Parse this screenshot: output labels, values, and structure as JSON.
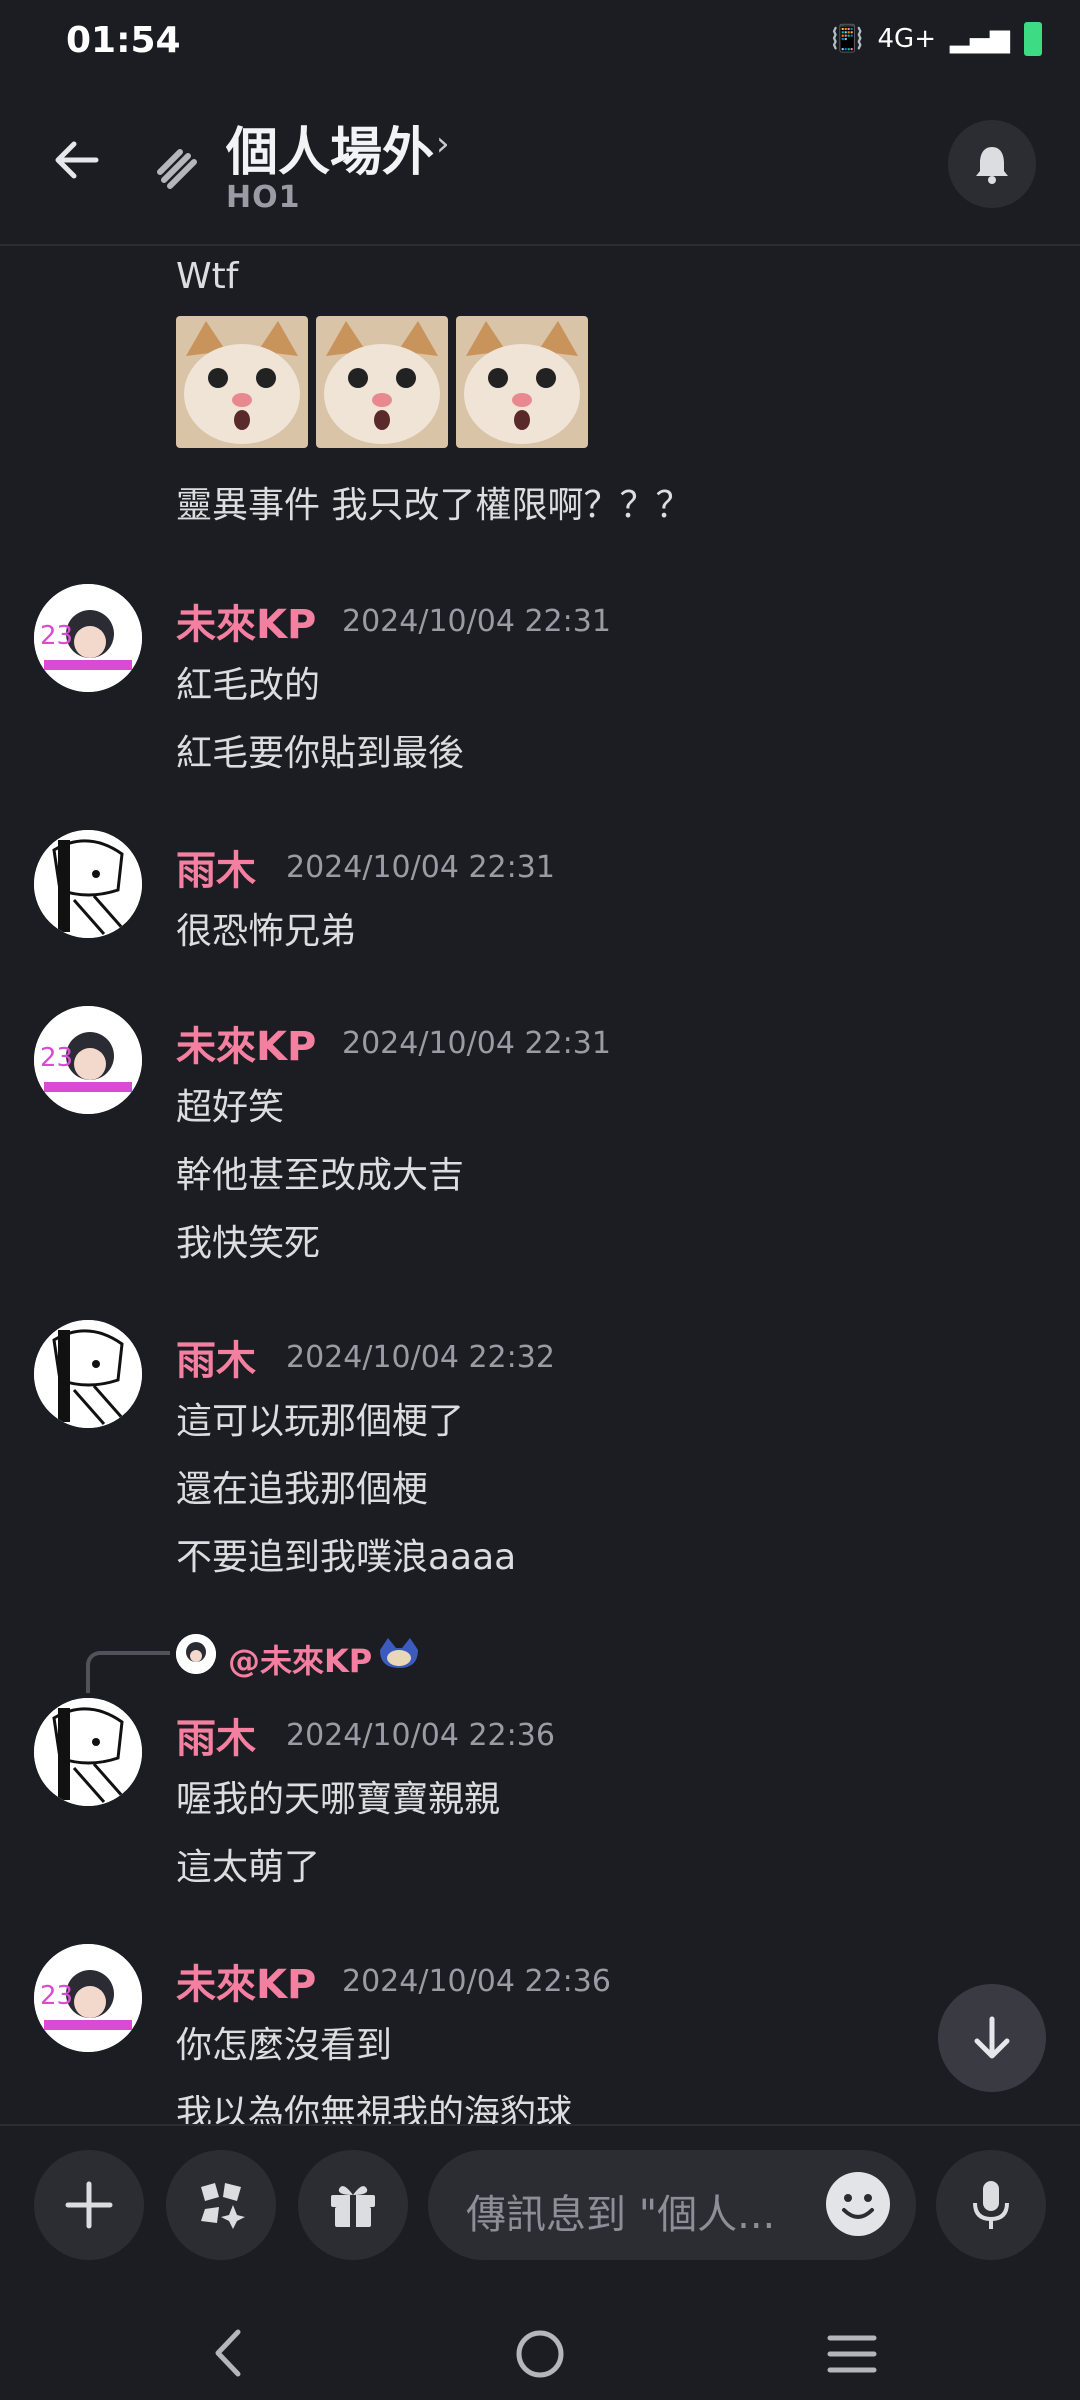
{
  "status_bar": {
    "time": "01:54",
    "network": "4G+"
  },
  "header": {
    "channel_name": "個人場外",
    "subtitle": "HO1",
    "back_icon": "arrow-left-icon",
    "bell_icon": "bell-icon"
  },
  "messages": {
    "m0": {
      "text": "Wtf",
      "images": [
        "cat-image-1",
        "cat-image-2",
        "cat-image-3"
      ],
      "text2": "靈異事件 我只改了權限啊？？？"
    },
    "m1": {
      "author": "未來KP",
      "time": "2024/10/04 22:31",
      "lines": [
        "紅毛改的",
        "紅毛要你貼到最後"
      ]
    },
    "m2": {
      "author": "雨木",
      "time": "2024/10/04 22:31",
      "lines": [
        "很恐怖兄弟"
      ]
    },
    "m3": {
      "author": "未來KP",
      "time": "2024/10/04 22:31",
      "lines": [
        "超好笑",
        "幹他甚至改成大吉",
        "我快笑死"
      ]
    },
    "m4": {
      "author": "雨木",
      "time": "2024/10/04 22:32",
      "lines": [
        "這可以玩那個梗了",
        "還在追我那個梗",
        "不要追到我噗浪aaaa"
      ]
    },
    "m5": {
      "reply_to": "@未來KP",
      "author": "雨木",
      "time": "2024/10/04 22:36",
      "lines": [
        "喔我的天哪寶寶親親",
        "這太萌了"
      ]
    },
    "m6": {
      "author": "未來KP",
      "time": "2024/10/04 22:36",
      "lines": [
        "你怎麼沒看到",
        "我以為你無視我的海豹球"
      ]
    }
  },
  "input": {
    "placeholder": "傳訊息到 \"個人...",
    "buttons": [
      "plus-icon",
      "apps-icon",
      "gift-icon",
      "emoji-icon",
      "microphone-icon"
    ]
  },
  "colors": {
    "background": "#1c1d22",
    "author": "#f47fa0",
    "timestamp": "#9a9ca4",
    "text": "#dcdde1"
  }
}
